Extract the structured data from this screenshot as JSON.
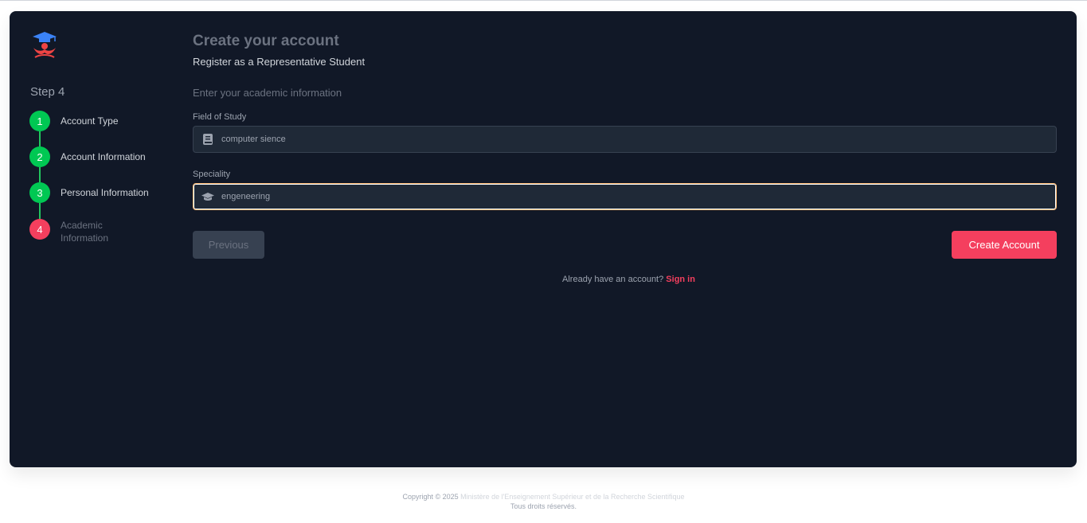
{
  "sidebar": {
    "step_title": "Step 4",
    "steps": [
      {
        "number": "1",
        "label": "Account Type",
        "status": "complete"
      },
      {
        "number": "2",
        "label": "Account Information",
        "status": "complete"
      },
      {
        "number": "3",
        "label": "Personal Information",
        "status": "complete"
      },
      {
        "number": "4",
        "label": "Academic Information",
        "status": "active"
      }
    ]
  },
  "form": {
    "title": "Create your account",
    "subtitle": "Register as a Representative Student",
    "section_title": "Enter your academic information",
    "fields": {
      "field_of_study": {
        "label": "Field of Study",
        "value": "computer sience",
        "icon": "book-icon"
      },
      "speciality": {
        "label": "Speciality",
        "value": "engeneering",
        "icon": "graduation-cap-icon"
      }
    },
    "previous_label": "Previous",
    "create_label": "Create Account",
    "signin_prompt": "Already have an account?",
    "signin_link": "Sign in"
  },
  "footer": {
    "copyright": "Copyright © 2025",
    "organization": "Ministère de l'Enseignement Supérieur et de la Recherche Scientifique",
    "rights": "Tous droits réservés."
  },
  "colors": {
    "card_bg": "#111827",
    "complete": "#00c853",
    "active": "#f43f5e",
    "accent": "#f43f5e"
  }
}
